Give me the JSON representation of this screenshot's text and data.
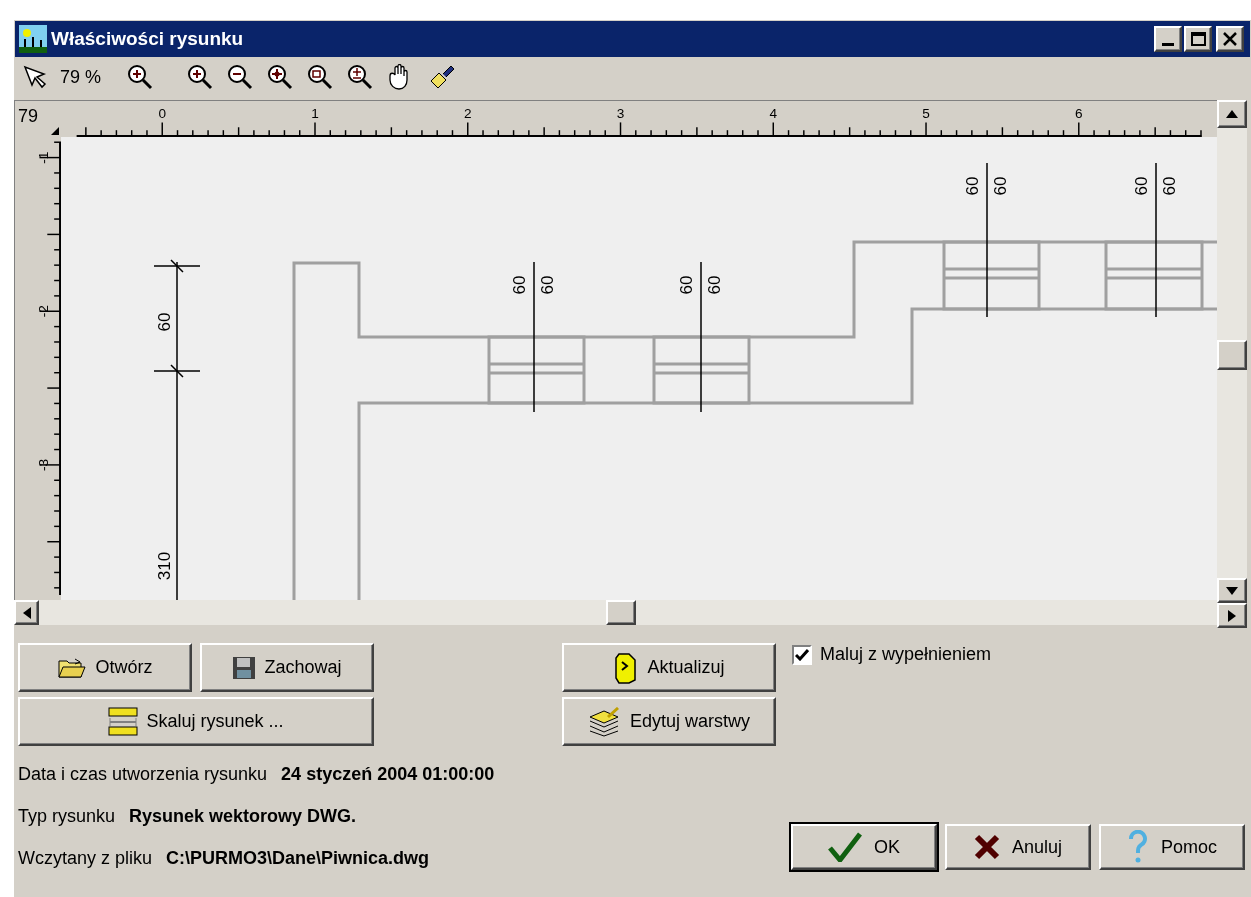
{
  "window": {
    "title": "Właściwości rysunku"
  },
  "toolbar": {
    "zoom_label": "79 %"
  },
  "rulers": {
    "corner": "79",
    "top_labels": [
      "0",
      "1",
      "2",
      "3",
      "4",
      "5",
      "6"
    ],
    "left_labels": [
      "-1",
      "-2",
      "-3"
    ]
  },
  "drawing": {
    "dimension_labels": [
      "60",
      "310",
      "60",
      "60",
      "60",
      "60",
      "60",
      "60",
      "60",
      "60"
    ]
  },
  "buttons": [
    {
      "label": "Otwórz"
    },
    {
      "label": "Zachowaj"
    },
    {
      "label": "Aktualizuj"
    },
    {
      "label": "Skaluj rysunek ..."
    },
    {
      "label": "Edytuj warstwy"
    }
  ],
  "fill_checkbox": {
    "label": "Maluj z wypełnieniem",
    "checked": true
  },
  "info": [
    {
      "label": "Data i czas utworzenia rysunku",
      "value": "24 styczeń 2004 01:00:00"
    },
    {
      "label": "Typ rysunku",
      "value": "Rysunek wektorowy DWG."
    },
    {
      "label": "Wczytany z pliku",
      "value": "C:\\PURMO3\\Dane\\Piwnica.dwg"
    }
  ],
  "dialog_buttons": [
    {
      "label": "OK",
      "default": true
    },
    {
      "label": "Anuluj",
      "default": false
    },
    {
      "label": "Pomoc",
      "default": false
    }
  ]
}
